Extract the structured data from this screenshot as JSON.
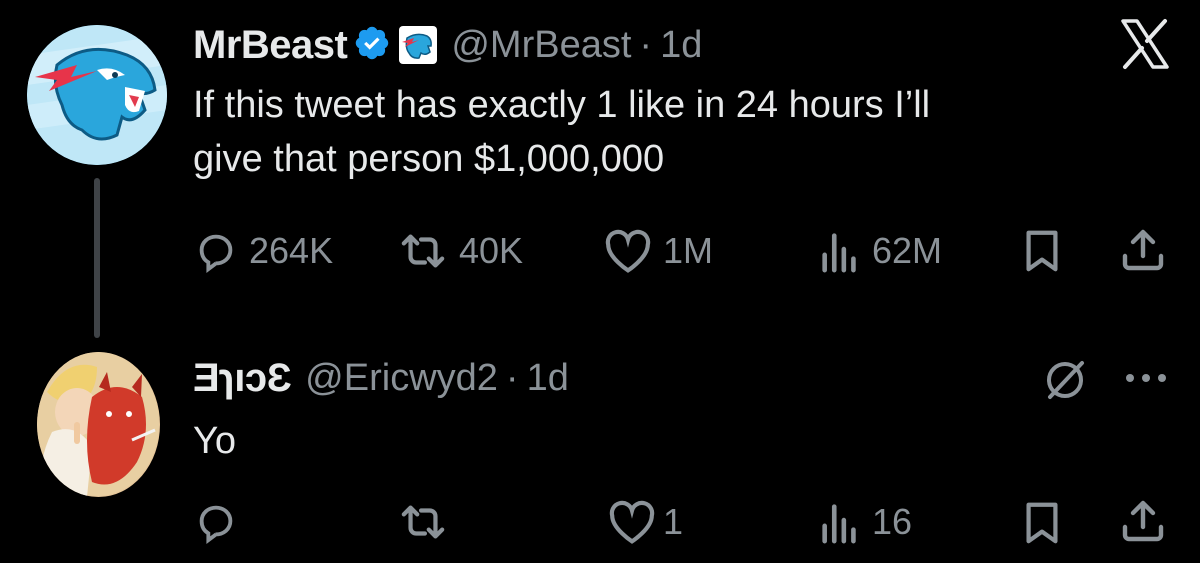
{
  "tweet": {
    "author_name": "MrBeast",
    "handle": "@MrBeast",
    "separator": "·",
    "time": "1d",
    "text_line1": "If this tweet has exactly 1 like in 24 hours I’ll",
    "text_line2": "give that person $1,000,000",
    "replies": "264K",
    "retweets": "40K",
    "likes": "1M",
    "views": "62M",
    "brand_icon": "x-logo-icon",
    "verified_icon": "verified-badge-icon",
    "affiliate_icon": "mrbeast-affiliate-badge-icon"
  },
  "reply": {
    "author_name": "ƎɿıɔƐ",
    "handle": "@Ericwyd2",
    "separator": "·",
    "time": "1d",
    "text": "Yo",
    "replies": "",
    "retweets": "",
    "likes": "1",
    "views": "16",
    "status_icon": "null-circle-icon",
    "more_icon": "more-dots-icon"
  },
  "colors": {
    "background": "#000000",
    "text_primary": "#e7e9ea",
    "text_secondary": "#8b9298",
    "verified_blue": "#1d9bf0",
    "thread_line": "#3f4347"
  }
}
